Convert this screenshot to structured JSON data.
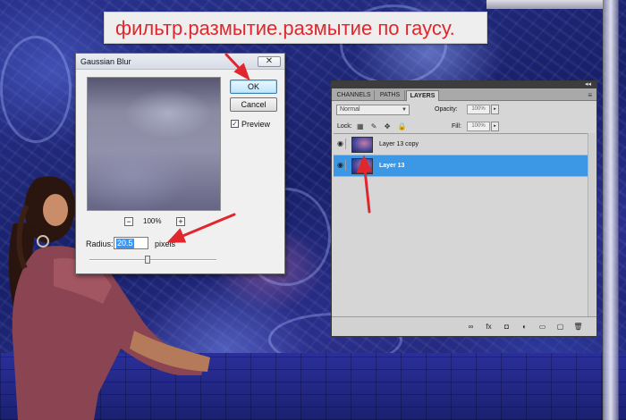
{
  "banner": {
    "text": "фильтр.размытие.размытие по гаусу."
  },
  "dialog": {
    "title": "Gaussian Blur",
    "close_label": "✕",
    "ok_label": "OK",
    "cancel_label": "Cancel",
    "preview_checked_mark": "✓",
    "preview_label": "Preview",
    "zoom_out_label": "−",
    "zoom_level": "100%",
    "zoom_in_label": "+",
    "radius_label": "Radius:",
    "radius_value": "20.5",
    "units_label": "pixels"
  },
  "layers_panel": {
    "collapse_label": "◂◂",
    "tabs": [
      {
        "label": "CHANNELS"
      },
      {
        "label": "PATHS"
      },
      {
        "label": "LAYERS"
      }
    ],
    "menu_icon": "≡",
    "blend_mode": "Normal",
    "opacity_label": "Opacity:",
    "opacity_value": "100%",
    "lock_label": "Lock:",
    "lock_icons": "▦ ✎ ✥ 🔒",
    "fill_label": "Fill:",
    "fill_value": "100%",
    "layers": [
      {
        "name": "Layer 13 copy",
        "visibility_icon": "◉"
      },
      {
        "name": "Layer 13",
        "visibility_icon": "◉"
      }
    ],
    "bottom_icons": [
      "∞",
      "fx",
      "◘",
      "◐",
      "▭",
      "▢",
      "🗑"
    ]
  },
  "colors": {
    "annotation_red": "#e0272d",
    "selection_blue": "#3c97e4",
    "banner_text": "#e0272d"
  }
}
